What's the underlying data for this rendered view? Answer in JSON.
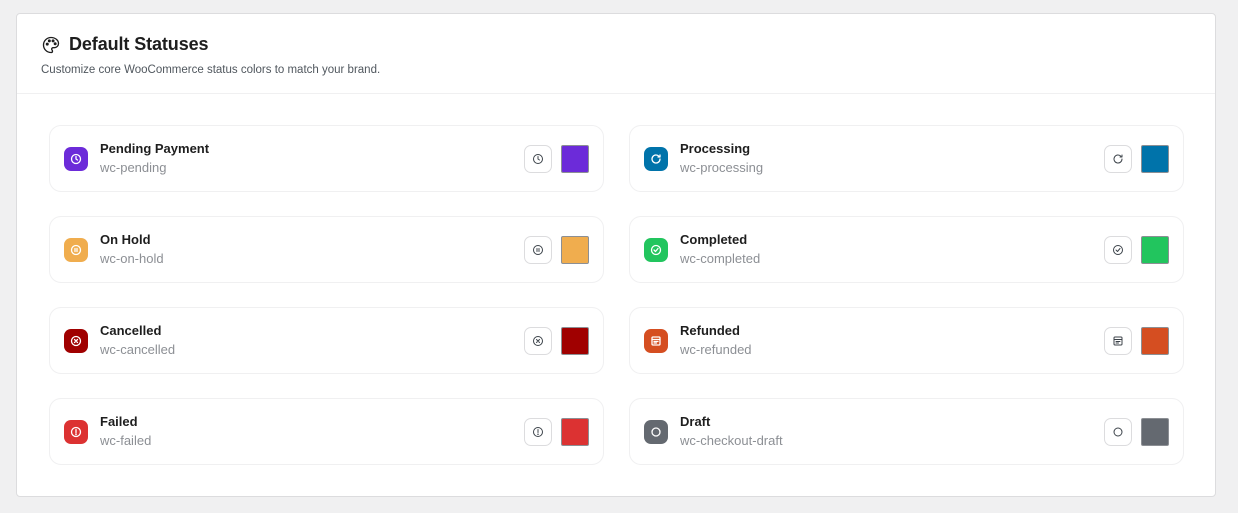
{
  "header": {
    "title": "Default Statuses",
    "subtitle": "Customize core WooCommerce status colors to match your brand.",
    "icon": "palette-icon"
  },
  "statuses": [
    {
      "name": "Pending Payment",
      "slug": "wc-pending",
      "color": "#6c2bd9",
      "icon": "clock-icon"
    },
    {
      "name": "Processing",
      "slug": "wc-processing",
      "color": "#0073aa",
      "icon": "refresh-icon"
    },
    {
      "name": "On Hold",
      "slug": "wc-on-hold",
      "color": "#f0ad4e",
      "icon": "pause-circle-icon"
    },
    {
      "name": "Completed",
      "slug": "wc-completed",
      "color": "#22c55e",
      "icon": "check-circle-icon"
    },
    {
      "name": "Cancelled",
      "slug": "wc-cancelled",
      "color": "#a00000",
      "icon": "x-circle-icon"
    },
    {
      "name": "Refunded",
      "slug": "wc-refunded",
      "color": "#d54e21",
      "icon": "receipt-icon"
    },
    {
      "name": "Failed",
      "slug": "wc-failed",
      "color": "#dc3232",
      "icon": "alert-circle-icon"
    },
    {
      "name": "Draft",
      "slug": "wc-checkout-draft",
      "color": "#646970",
      "icon": "circle-icon"
    }
  ]
}
